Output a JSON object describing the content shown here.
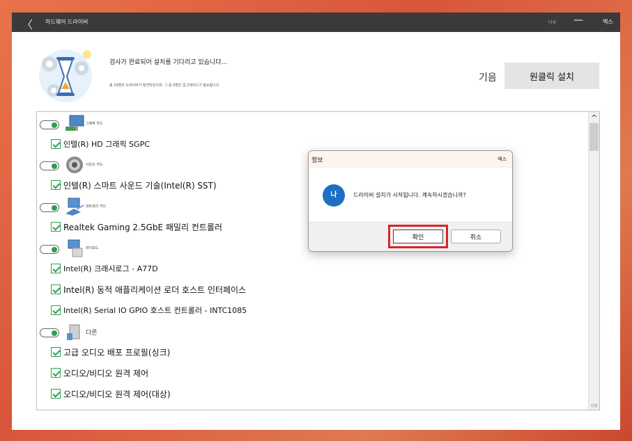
{
  "titlebar": {
    "back_glyph": "〈",
    "title": "하드웨어 드라이버",
    "minimize_label": "다섯",
    "minimize_glyph": "—",
    "close_label": "엑스"
  },
  "header": {
    "status": "검사가 완료되어 설치를 기다리고 있습니다...",
    "subtext": "총 33명의 드라이버가 발견되었으며, 그 중 0명은 업그레이드가 필요합니다",
    "language_label": "기음",
    "install_button": "원클릭 설치"
  },
  "scrollbar": {
    "up_glyph": "^",
    "label": "다섯"
  },
  "categories": [
    {
      "label": "그래픽 카드",
      "icon": "monitor-icon",
      "items": [
        "인텔(R) HD 그래픽 SGPC"
      ]
    },
    {
      "label": "사운드 카드",
      "icon": "speaker-icon",
      "items": [
        "인텔(R) 스마트 사운드 기술(Intel(R) SST)"
      ]
    },
    {
      "label": "네트워크 카드",
      "icon": "network-icon",
      "items": [
        "Realtek Gaming 2.5GbE 패밀리 컨트롤러"
      ]
    },
    {
      "label": "마더보드",
      "icon": "motherboard-icon",
      "items": [
        "Intel(R) 크래시로그 - A77D",
        "Intel(R) 동적 애플리케이션 로더 호스트 인터페이스",
        "Intel(R) Serial IO GPIO 호스트 컨트롤러 - INTC1085"
      ]
    },
    {
      "label": "다른",
      "icon": "device-icon",
      "items": [
        "고급 오디오 배포 프로필(싱크)",
        "오디오/비디오 원격 제어",
        "오디오/비디오 원격 제어(대상)"
      ]
    }
  ],
  "dialog": {
    "title": "정보",
    "close_label": "엑스",
    "icon_text": "나",
    "message": "드라이버 설치가 시작됩니다. 계속하시겠습니까?",
    "ok_label": "확인",
    "cancel_label": "취소"
  },
  "colors": {
    "accent_green": "#2e9e4f",
    "info_blue": "#1e6fc2",
    "highlight_red": "#d8232a",
    "titlebar": "#3a3a3a"
  }
}
